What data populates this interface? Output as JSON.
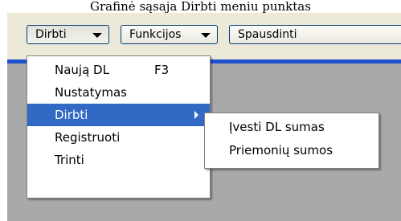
{
  "caption": "Grafinė sąsaja Dirbti meniu punktas",
  "toolbar": {
    "dirbti": "Dirbti",
    "funkcijos": "Funkcijos",
    "spausdinti": "Spausdinti"
  },
  "menu": {
    "items": [
      {
        "label": "Naują DL",
        "shortcut": "F3"
      },
      {
        "label": "Nustatymas"
      },
      {
        "label": "Dirbti"
      },
      {
        "label": "Registruoti"
      },
      {
        "label": "Trinti"
      }
    ]
  },
  "submenu": {
    "items": [
      {
        "label": "Įvesti DL sumas"
      },
      {
        "label": "Priemonių sumos"
      }
    ]
  },
  "colors": {
    "accent_bar": "#1f4fcf",
    "highlight": "#316ac5",
    "client_bg": "#a9a9a9",
    "chrome_bg": "#ece9d8"
  }
}
